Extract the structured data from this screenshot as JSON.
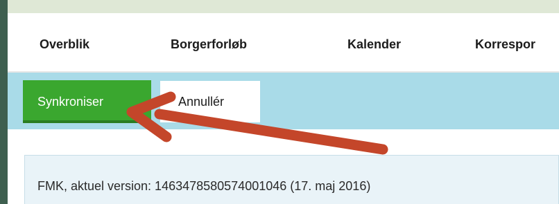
{
  "nav": {
    "tabs": [
      {
        "label": "Overblik"
      },
      {
        "label": "Borgerforløb"
      },
      {
        "label": "Kalender"
      },
      {
        "label": "Korrespor"
      }
    ]
  },
  "toolbar": {
    "sync_label": "Synkroniser",
    "cancel_label": "Annullér"
  },
  "info": {
    "text": "FMK, aktuel version: 1463478580574001046 (17. maj 2016)"
  },
  "colors": {
    "sync_button": "#3aa72f",
    "toolbar_bg": "#a9dbe8",
    "info_bg": "#e9f3f8",
    "annotation_arrow": "#c4462a"
  },
  "annotation": {
    "arrow_icon": "red-arrow-pointing-to-sync-button"
  }
}
